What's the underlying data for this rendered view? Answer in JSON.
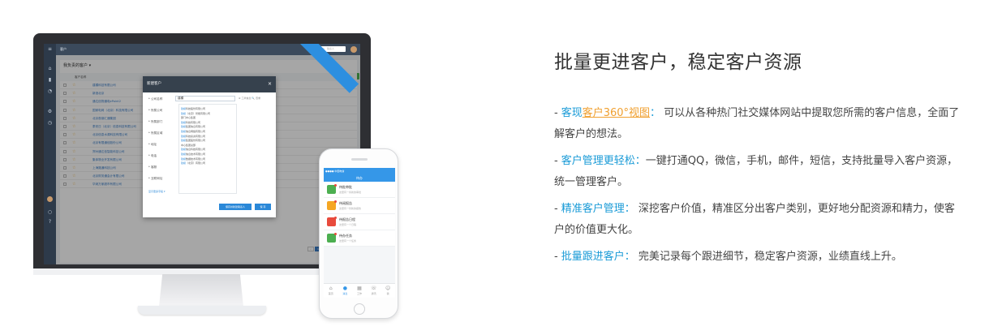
{
  "hero": {
    "headline": "批量更进客户，稳定客户资源"
  },
  "features": [
    {
      "lead_prefix": "客现",
      "link_text": "客户360°视图",
      "lead_suffix": "：",
      "text": "  可以从各种热门社交媒体网站中提取您所需的客户信息，全面了解客户的想法。"
    },
    {
      "lead": "客户管理更轻松：",
      "text": "一键打通QQ，微信，手机，邮件，短信，支持批量导入客户资源，统一管理客户。"
    },
    {
      "lead": "精准客户管理：",
      "text": "  深挖客户价值，精准区分出客户类别，更好地分配资源和精力，使客户的价值更大化。"
    },
    {
      "lead": "批量跟进客户：",
      "text": "  完美记录每个跟进细节，稳定客户资源，业绩直线上升。"
    }
  ],
  "desktop": {
    "topbar_title": "客户",
    "search_placeholder": "搜索客户、联系人",
    "list_title": "我负责的客户 ▾",
    "column_name": "客户名称",
    "rows": [
      "建模科技有限公司",
      "新浪北京",
      "通达信物通电ePoint2",
      "国家电网（北京）科技有限公司",
      "北京首钢汇通集团",
      "泰安日（北京）信息科技有限公司",
      "北京信息水源科技有限公司",
      "北京有限通信股份公司",
      "郑州通达信智能科技公司",
      "集体物业开发有限公司",
      "上海路通科技公司",
      "北京财务通会计有限公司",
      "华润万家超市有限公司"
    ],
    "pager": [
      "‹",
      "1",
      "2",
      "3",
      "4",
      "»"
    ],
    "modal": {
      "title": "新建客户",
      "close": "×",
      "fields": [
        "* 公司名称",
        "* 所属公司",
        "* 所属部门",
        "* 所属区域",
        "* 地址",
        "* 电话",
        "* 客服",
        "* 互联网址"
      ],
      "name_value": "建模",
      "extra": "⊕ 工商信息  🔍 查重",
      "suggestions": [
        {
          "hl": "建模",
          "rest": "科技股份有限公司"
        },
        {
          "hl": "建模",
          "rest": "（北京）智能有限公司"
        },
        {
          "hl": "",
          "rest": "部门中心集团"
        },
        {
          "hl": "建模",
          "rest": "科技有限公司"
        },
        {
          "hl": "建模",
          "rest": "集团信息有限公司"
        },
        {
          "hl": "建模",
          "rest": "信息网络有限公司"
        },
        {
          "hl": "建模",
          "rest": "科技投资有限公司"
        },
        {
          "hl": "建模",
          "rest": "集团股份有限公司"
        },
        {
          "hl": "",
          "rest": "中心集团总部"
        },
        {
          "hl": "建模",
          "rest": "信息科技有限公司"
        },
        {
          "hl": "建模",
          "rest": "信息技术有限公司"
        },
        {
          "hl": "建模",
          "rest": "数据技术有限公司"
        },
        {
          "hl": "建模",
          "rest": "（北京）有限公司"
        }
      ],
      "more_link": "显示更多字段 ▾",
      "btn_save_new": "保存并新建联系人",
      "btn_save": "保 存"
    }
  },
  "phone": {
    "status": "●●●● 中国电信 ",
    "title": "待办",
    "items": [
      {
        "title": "待批审批",
        "sub": "这里有一条新的审批",
        "color": "#4caf50",
        "icon": "approval-icon"
      },
      {
        "title": "待阅报告",
        "sub": "这里有一份新的报告",
        "color": "#f5a623",
        "icon": "report-icon"
      },
      {
        "title": "待报告日程",
        "sub": "这里有一个日程",
        "color": "#e84a3c",
        "icon": "calendar-icon"
      },
      {
        "title": "待办任务",
        "sub": "这里有一个任务",
        "color": "#4caf50",
        "icon": "task-icon"
      }
    ],
    "tabs": [
      {
        "label": "首页",
        "glyph": "⌂"
      },
      {
        "label": "消息",
        "glyph": "●"
      },
      {
        "label": "工作",
        "glyph": "▦"
      },
      {
        "label": "通讯",
        "glyph": "☏"
      },
      {
        "label": "我",
        "glyph": "☺"
      }
    ]
  }
}
